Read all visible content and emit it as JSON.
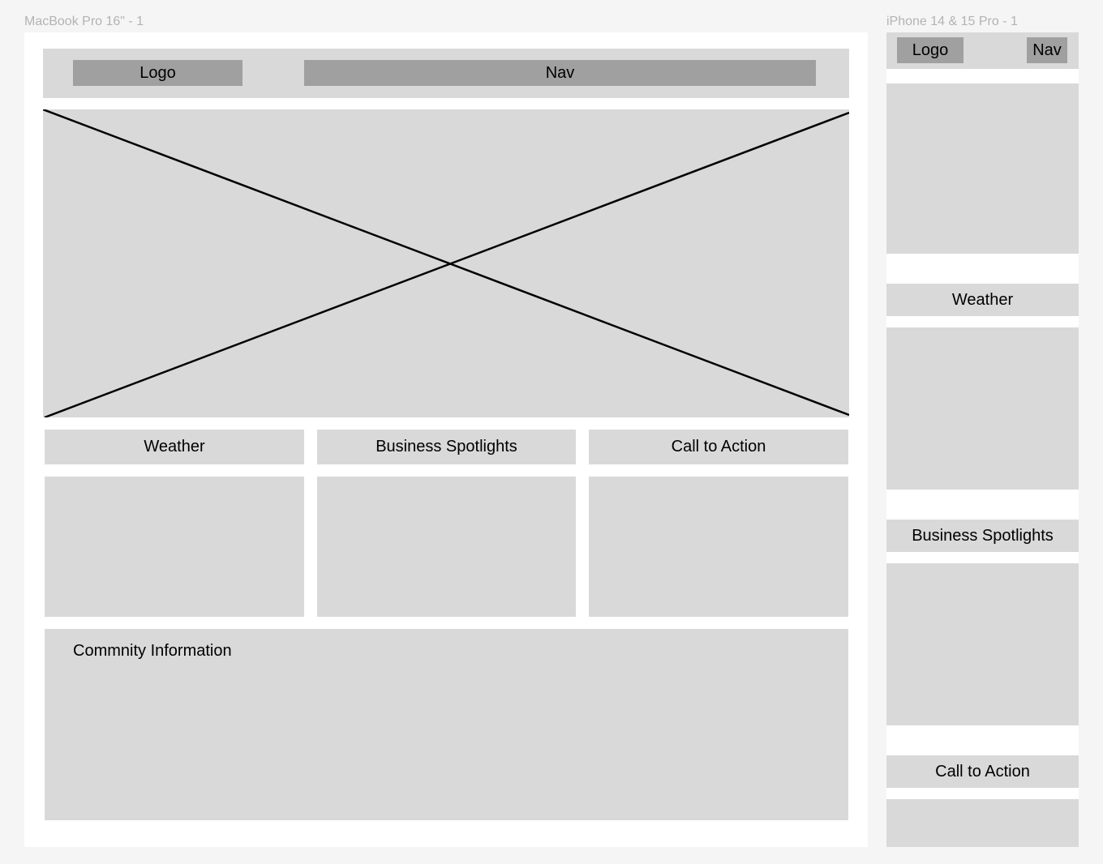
{
  "desktop": {
    "frame_title": "MacBook Pro 16\" - 1",
    "header": {
      "logo_label": "Logo",
      "nav_label": "Nav"
    },
    "hero": {
      "placeholder": "image-placeholder"
    },
    "columns": [
      {
        "title": "Weather"
      },
      {
        "title": "Business Spotlights"
      },
      {
        "title": "Call to Action"
      }
    ],
    "community": {
      "title": "Commnity Information"
    }
  },
  "mobile": {
    "frame_title": "iPhone 14 & 15 Pro - 1",
    "header": {
      "logo_label": "Logo",
      "nav_label": "Nav"
    },
    "sections": [
      {
        "title": "Weather"
      },
      {
        "title": "Business Spotlights"
      },
      {
        "title": "Call to Action"
      }
    ]
  },
  "colors": {
    "canvas": "#f5f5f5",
    "frame": "#ffffff",
    "placeholder": "#d9d9d9",
    "header_block": "#a0a0a0",
    "frame_label": "#b3b3b3"
  }
}
